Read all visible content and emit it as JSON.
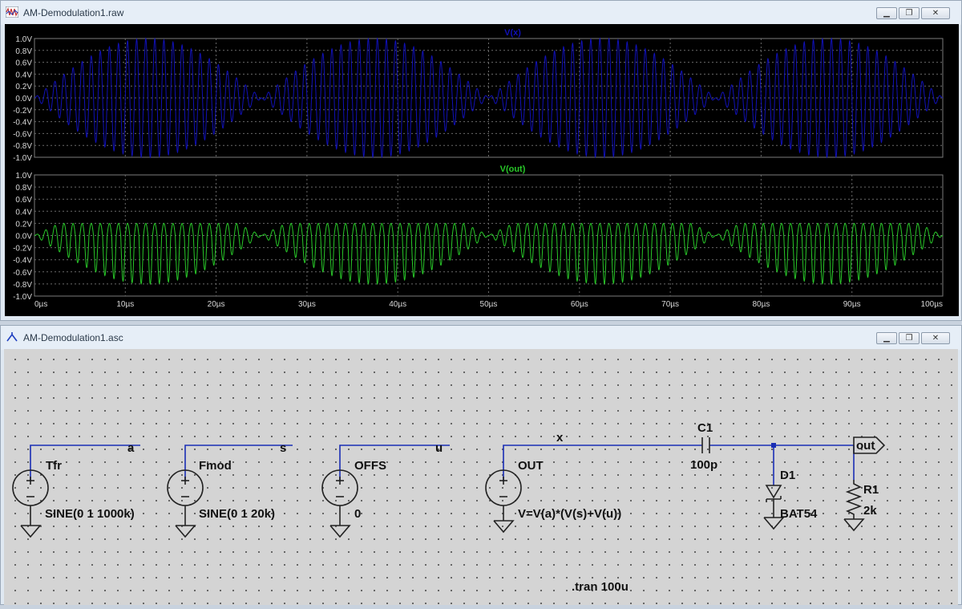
{
  "plot_window": {
    "title": "AM-Demodulation1.raw",
    "buttons": [
      "minimize",
      "maximize",
      "close"
    ]
  },
  "schematic_window": {
    "title": "AM-Demodulation1.asc",
    "buttons": [
      "minimize",
      "maximize",
      "close"
    ]
  },
  "chart_data": [
    {
      "type": "line",
      "title": "V(x)",
      "color": "#1010b8",
      "xlim": [
        0,
        100
      ],
      "ylim": [
        -1.0,
        1.0
      ],
      "x_ticks": [
        "0µs",
        "10µs",
        "20µs",
        "30µs",
        "40µs",
        "50µs",
        "60µs",
        "70µs",
        "80µs",
        "90µs",
        "100µs"
      ],
      "y_ticks": [
        "1.0V",
        "0.8V",
        "0.6V",
        "0.4V",
        "0.2V",
        "0.0V",
        "-0.2V",
        "-0.4V",
        "-0.6V",
        "-0.8V",
        "-1.0V"
      ],
      "grid": true,
      "series": [
        {
          "name": "V(x)",
          "carrier_frequency_MHz": 1.0,
          "envelope": "|sin(2π·20kHz·t)|",
          "peak": 1.0
        }
      ]
    },
    {
      "type": "line",
      "title": "V(out)",
      "color": "#28c828",
      "xlim": [
        0,
        100
      ],
      "ylim": [
        -1.0,
        1.0
      ],
      "x_ticks": [
        "0µs",
        "10µs",
        "20µs",
        "30µs",
        "40µs",
        "50µs",
        "60µs",
        "70µs",
        "80µs",
        "90µs",
        "100µs"
      ],
      "y_ticks": [
        "1.0V",
        "0.8V",
        "0.6V",
        "0.4V",
        "0.2V",
        "0.0V",
        "-0.2V",
        "-0.4V",
        "-0.6V",
        "-0.8V",
        "-1.0V"
      ],
      "grid": true,
      "series": [
        {
          "name": "V(out)",
          "carrier_frequency_MHz": 1.0,
          "max": 0.2,
          "min": -0.8
        }
      ]
    }
  ],
  "schematic": {
    "sources": [
      {
        "name": "Tfr",
        "value": "SINE(0 1 1000k)",
        "net": "a"
      },
      {
        "name": "Fmod",
        "value": "SINE(0 1 20k)",
        "net": "s"
      },
      {
        "name": "OFFS",
        "value": "0",
        "net": "u"
      },
      {
        "name": "OUT",
        "value": "V=V(a)*(V(s)+V(u))",
        "net": "x"
      }
    ],
    "capacitor": {
      "name": "C1",
      "value": "100p"
    },
    "diode": {
      "name": "D1",
      "value": "BAT54"
    },
    "resistor": {
      "name": "R1",
      "value": "2k"
    },
    "out_label": "out",
    "directive": ".tran 100u"
  },
  "colors": {
    "wire": "#1a2eb5",
    "component": "#222222",
    "junction": "#1a2eb5"
  }
}
